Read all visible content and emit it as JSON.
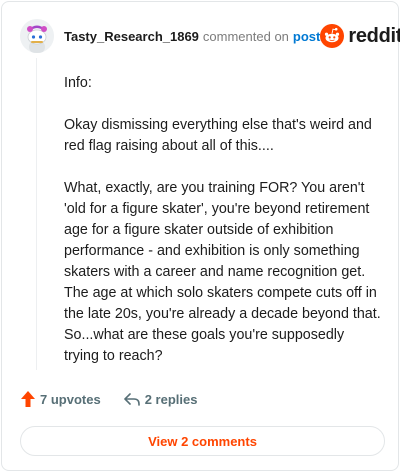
{
  "comment": {
    "username": "Tasty_Research_1869",
    "commented_text": "commented on",
    "post_link": "post",
    "paragraphs": [
      "Info:",
      "Okay dismissing everything else that's weird and red flag raising about all of this....",
      "What, exactly, are you training FOR? You aren't 'old for a figure skater', you're beyond retirement age for a figure skater outside of exhibition performance - and exhibition is only something skaters with a career and name recognition get. The age at which solo skaters compete cuts off in the late 20s, you're already a decade beyond that. So...what are these goals you're supposedly trying to reach?"
    ]
  },
  "brand": {
    "name": "reddit",
    "icon": "reddit-logo-icon",
    "color": "#ff4500"
  },
  "actions": {
    "upvotes": "7 upvotes",
    "replies": "2 replies",
    "upvote_icon": "upvote-arrow-icon",
    "reply_icon": "reply-arrow-icon",
    "upvote_color": "#ff4500"
  },
  "footer": {
    "view_comments": "View 2 comments"
  }
}
